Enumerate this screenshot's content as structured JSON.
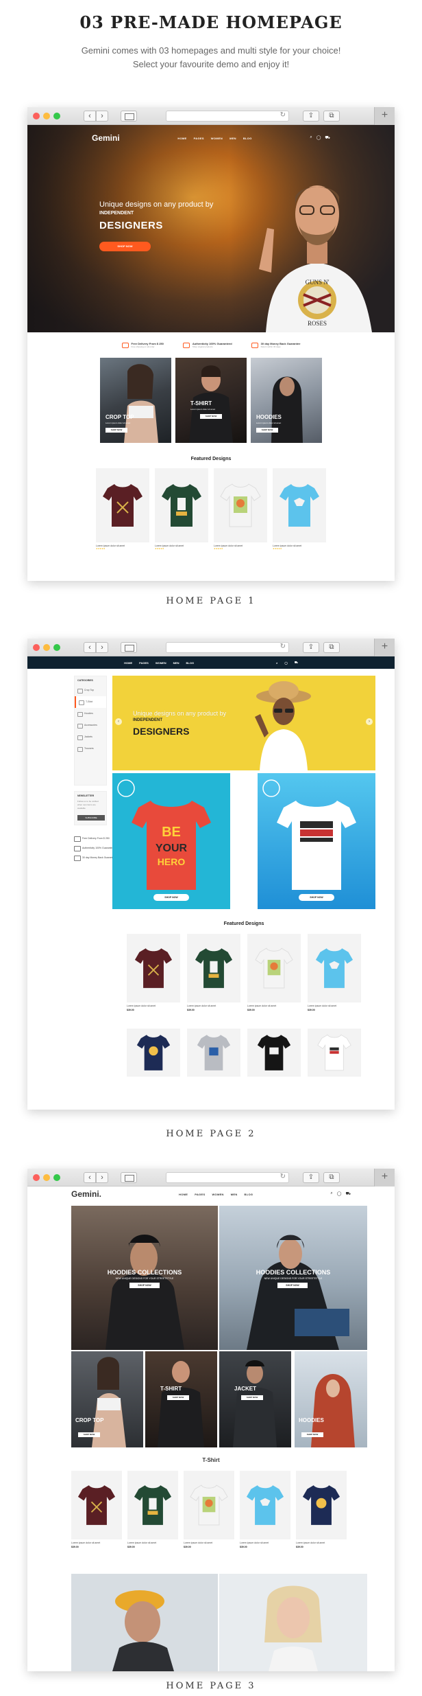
{
  "heading": "03 PRE-MADE HOMEPAGE",
  "description_line1": "Gemini comes with 03 homepages and multi style for your choice!",
  "description_line2": "Select your favourite demo and enjoy it!",
  "captions": {
    "home1": "HOME PAGE 1",
    "home2": "HOME PAGE 2",
    "home3": "HOME PAGE 3"
  },
  "browser": {
    "back": "‹",
    "forward": "›",
    "reload": "↻",
    "share": "⇪",
    "tabs": "⧉",
    "new_tab": "+"
  },
  "colors": {
    "accent": "#ff5a1f",
    "dark_nav": "#0f2230",
    "yellow_banner": "#f2d23a",
    "teal_banner": "#23b6d6",
    "blue_banner": "#1fa6e0"
  },
  "icons": {
    "search": "search-icon",
    "user": "user-icon",
    "cart": "cart-icon"
  },
  "home1": {
    "logo": "Gemini",
    "menu": [
      "HOME",
      "PAGES",
      "WOMEN",
      "MEN",
      "BLOG"
    ],
    "hero_kicker": "Unique designs on any product by",
    "hero_kicker2": "INDEPENDENT",
    "hero_big": "DESIGNERS",
    "hero_cta": "SHOP NOW",
    "features": [
      {
        "title": "Free Delivery From $ 250",
        "sub": "Free shipping on all order"
      },
      {
        "title": "Authenticity 100% Guaranteed",
        "sub": "Shop original products"
      },
      {
        "title": "30 day Money Back Guarantee",
        "sub": "Return within 30 days"
      }
    ],
    "categories": [
      {
        "title": "CROP TOP",
        "sub": "Lorem ipsum dolor sit amet",
        "button": "SHOP NOW"
      },
      {
        "title": "T-SHIRT",
        "sub": "Lorem ipsum dolor sit amet",
        "button": "SHOP NOW"
      },
      {
        "title": "HOODIES",
        "sub": "Lorem ipsum dolor sit amet",
        "button": "SHOP NOW"
      }
    ],
    "featured_title": "Featured Designs",
    "products": [
      {
        "name": "Lorem ipsum dolor sit amet"
      },
      {
        "name": "Lorem ipsum dolor sit amet"
      },
      {
        "name": "Lorem ipsum dolor sit amet"
      },
      {
        "name": "Lorem ipsum dolor sit amet"
      }
    ]
  },
  "home2": {
    "menu": [
      "HOME",
      "PAGES",
      "WOMEN",
      "MEN",
      "BLOG"
    ],
    "categories_header": "CATEGORIES",
    "categories": [
      "Crop Top",
      "T-Shirt",
      "Hoodies",
      "Accessories",
      "Jackets",
      "Trousers"
    ],
    "newsletter_title": "NEWSLETTER",
    "newsletter_text": "Follow us to be notified when new items are available",
    "newsletter_button": "SUBSCRIBE",
    "perks": [
      "Free Delivery From $ 250",
      "Authenticity 100% Guaranteed",
      "30 day Money Back Guarantee"
    ],
    "hero_kicker": "Unique designs on any product by",
    "hero_kicker2": "INDEPENDENT",
    "hero_big": "DESIGNERS",
    "banner_button": "SHOP NOW",
    "featured_title": "Featured Designs",
    "products": [
      {
        "name": "Lorem ipsum dolor sit amet",
        "price": "$39.00"
      },
      {
        "name": "Lorem ipsum dolor sit amet",
        "price": "$39.00"
      },
      {
        "name": "Lorem ipsum dolor sit amet",
        "price": "$39.00"
      },
      {
        "name": "Lorem ipsum dolor sit amet",
        "price": "$39.00"
      }
    ]
  },
  "home3": {
    "logo": "Gemini.",
    "menu": [
      "HOME",
      "PAGES",
      "WOMEN",
      "MEN",
      "BLOG"
    ],
    "big_banners": [
      {
        "title": "HOODIES COLLECTIONS",
        "sub": "NEW UNIQUE DESIGNS FOR YOUR STREETSTYLE",
        "button": "SHOP NOW"
      },
      {
        "title": "HOODIES COLLECTIONS",
        "sub": "NEW UNIQUE DESIGNS FOR YOUR STREETSTYLE",
        "button": "SHOP NOW"
      }
    ],
    "small_banners": [
      {
        "title": "CROP TOP",
        "button": "SHOP NOW"
      },
      {
        "title": "T-SHIRT",
        "button": "SHOP NOW"
      },
      {
        "title": "JACKET",
        "button": "SHOP NOW"
      },
      {
        "title": "HOODIES",
        "button": "SHOP NOW"
      }
    ],
    "tshirt_title": "T-Shirt",
    "products": [
      {
        "name": "Lorem ipsum dolor sit amet",
        "price": "$39.00"
      },
      {
        "name": "Lorem ipsum dolor sit amet",
        "price": "$39.00"
      },
      {
        "name": "Lorem ipsum dolor sit amet",
        "price": "$39.00"
      },
      {
        "name": "Lorem ipsum dolor sit amet",
        "price": "$39.00"
      },
      {
        "name": "Lorem ipsum dolor sit amet",
        "price": "$39.00"
      }
    ]
  }
}
